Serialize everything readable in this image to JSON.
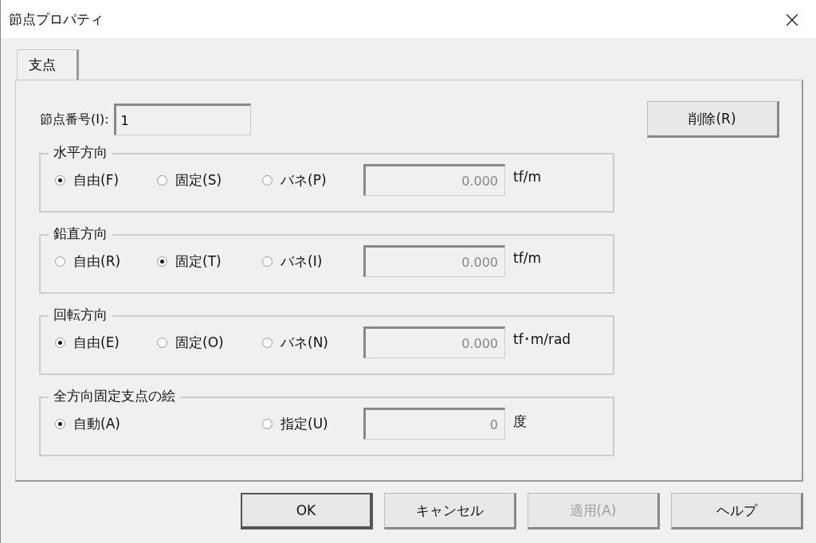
{
  "window": {
    "title": "節点プロパティ",
    "close": "×"
  },
  "tabs": [
    {
      "label": "支点",
      "selected": true
    }
  ],
  "node_number": {
    "label": "節点番号(I):",
    "value": "1"
  },
  "delete_button": "削除(R)",
  "groups": [
    {
      "title": "水平方向",
      "options": [
        {
          "label": "自由(F)",
          "selected": true
        },
        {
          "label": "固定(S)",
          "selected": false
        },
        {
          "label": "バネ(P)",
          "selected": false
        }
      ],
      "value": "0.000",
      "unit": "tf/m"
    },
    {
      "title": "鉛直方向",
      "options": [
        {
          "label": "自由(R)",
          "selected": false
        },
        {
          "label": "固定(T)",
          "selected": true
        },
        {
          "label": "バネ(I)",
          "selected": false
        }
      ],
      "value": "0.000",
      "unit": "tf/m"
    },
    {
      "title": "回転方向",
      "options": [
        {
          "label": "自由(E)",
          "selected": true
        },
        {
          "label": "固定(O)",
          "selected": false
        },
        {
          "label": "バネ(N)",
          "selected": false
        }
      ],
      "value": "0.000",
      "unit": "tf･m/rad"
    },
    {
      "title": "全方向固定支点の絵",
      "options": [
        {
          "label": "自動(A)",
          "selected": true
        },
        {
          "label": "指定(U)",
          "selected": false
        }
      ],
      "value": "0",
      "unit": "度"
    }
  ],
  "buttons": [
    {
      "label": "OK",
      "disabled": false,
      "default": true
    },
    {
      "label": "キャンセル",
      "disabled": false,
      "default": false
    },
    {
      "label": "適用(A)",
      "disabled": true,
      "default": false
    },
    {
      "label": "ヘルプ",
      "disabled": false,
      "default": false
    }
  ]
}
